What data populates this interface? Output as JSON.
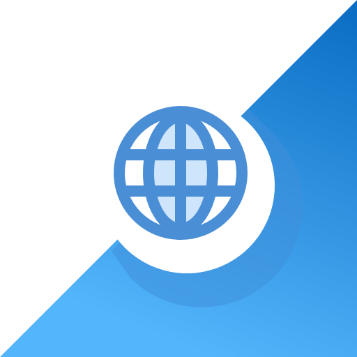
{
  "icon": {
    "name": "globe-icon",
    "colors": {
      "background": "#ffffff",
      "diagonal_gradient_top": "#0a6cc2",
      "diagonal_gradient_bottom": "#53b5fb",
      "ring_shadow": "#3f8fdb",
      "ring": "#ffffff",
      "globe_stroke": "#4a8fd6",
      "globe_fill": "#cfe5fb"
    }
  }
}
